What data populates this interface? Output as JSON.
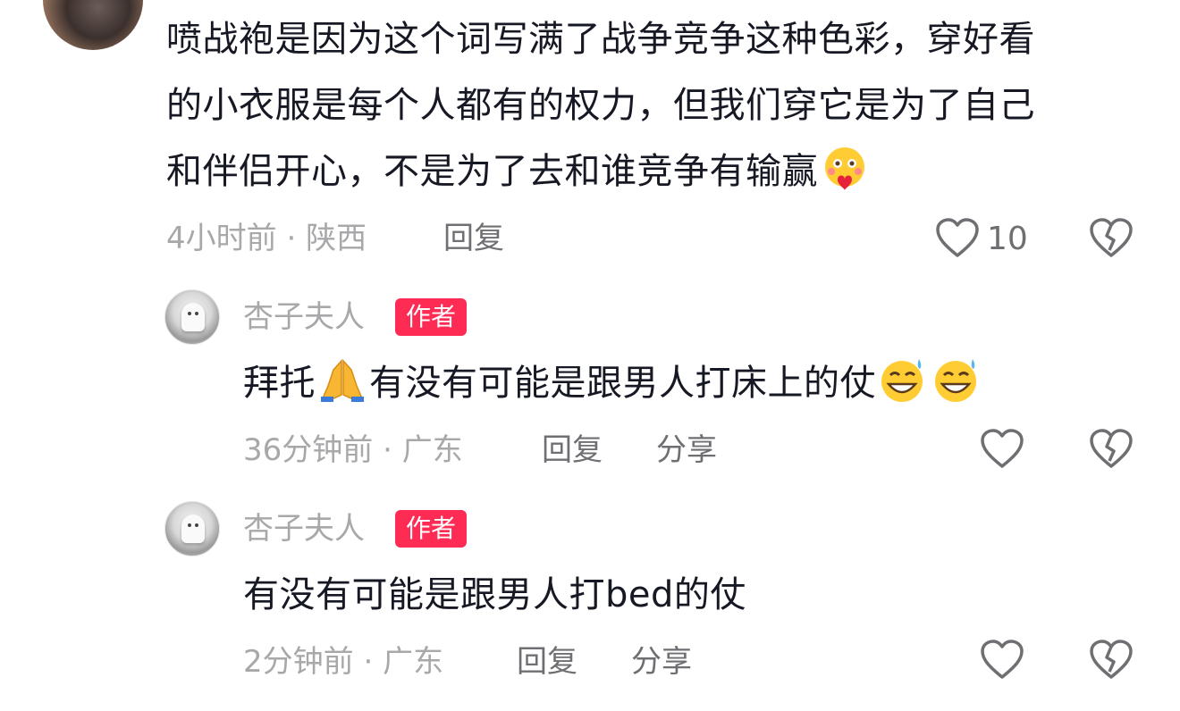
{
  "comments": [
    {
      "lines": [
        "喷战袍是因为这个词写满了战争竞争这种色彩，穿好看",
        "的小衣服是每个人都有的权力，但我们穿它是为了自己",
        "和伴侣开心，不是为了去和谁竞争有输赢"
      ],
      "emoji_end": "hugging-face",
      "time": "4小时前",
      "location": "陕西",
      "reply_label": "回复",
      "like_count": "10"
    }
  ],
  "replies": [
    {
      "username": "杏子夫人",
      "badge": "作者",
      "text_a": "拜托",
      "emoji_mid": "folded-hands",
      "text_b": "有没有可能是跟男人打床上的仗",
      "emoji_end": "grinning-sweat",
      "time": "36分钟前",
      "location": "广东",
      "reply_label": "回复",
      "share_label": "分享"
    },
    {
      "username": "杏子夫人",
      "badge": "作者",
      "text": "有没有可能是跟男人打bed的仗",
      "time": "2分钟前",
      "location": "广东",
      "reply_label": "回复",
      "share_label": "分享"
    }
  ],
  "meta_separator": " · ",
  "colors": {
    "badge": "#fe2c55",
    "meta": "#a8a8ab",
    "action": "#6f6f73",
    "text": "#161823"
  },
  "icons": {
    "like": "heart-outline-icon",
    "dislike": "broken-heart-icon"
  }
}
